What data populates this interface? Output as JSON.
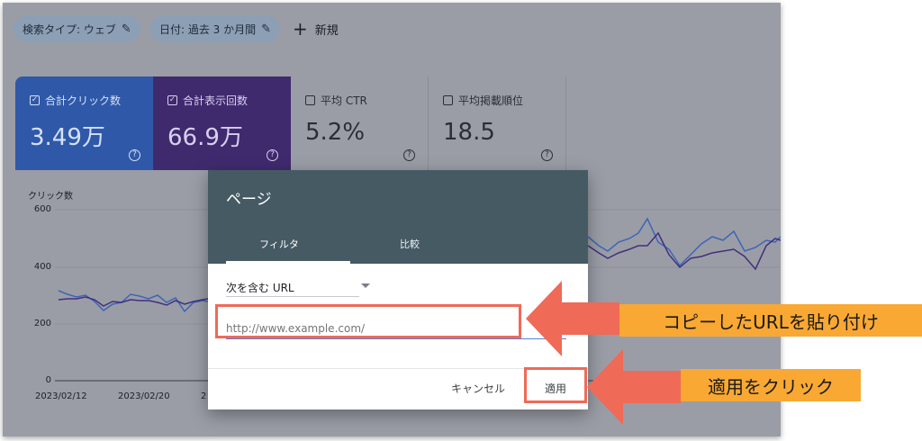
{
  "filters": {
    "search_type": "検索タイプ: ウェブ",
    "date": "日付: 過去 3 か月間",
    "new_label": "新規"
  },
  "metrics": [
    {
      "label": "合計クリック数",
      "value": "3.49万",
      "checked": true,
      "color": "#2f59a8"
    },
    {
      "label": "合計表示回数",
      "value": "66.9万",
      "checked": true,
      "color": "#3f2a6e"
    },
    {
      "label": "平均 CTR",
      "value": "5.2%",
      "checked": false
    },
    {
      "label": "平均掲載順位",
      "value": "18.5",
      "checked": false
    }
  ],
  "chart": {
    "y_label": "クリック数",
    "y_ticks": [
      "600",
      "400",
      "200",
      "0"
    ],
    "x_ticks": [
      "2023/02/12",
      "2023/02/20",
      "2"
    ]
  },
  "dialog": {
    "title": "ページ",
    "tabs": [
      "フィルタ",
      "比較"
    ],
    "selected_tab": "フィルタ",
    "condition": "次を含む URL",
    "url_placeholder": "http://www.example.com/",
    "cancel_label": "キャンセル",
    "apply_label": "適用"
  },
  "annotations": {
    "paste_callout": "コピーしたURLを貼り付け",
    "click_callout": "適用をクリック",
    "highlight_color": "#ef6a57",
    "callout_color": "#f9a833"
  }
}
